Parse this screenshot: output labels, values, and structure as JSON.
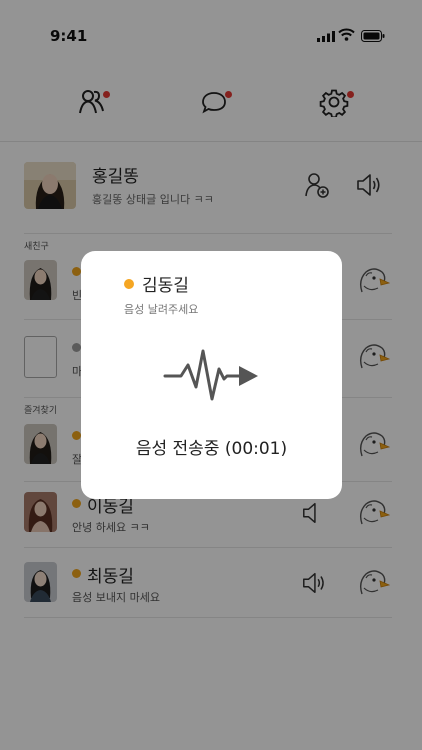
{
  "status_bar": {
    "time": "9:41"
  },
  "tabs": [
    {
      "name": "friends",
      "icon": "people-icon",
      "has_badge": true
    },
    {
      "name": "chats",
      "icon": "chat-bubble-icon",
      "has_badge": true
    },
    {
      "name": "settings",
      "icon": "gear-icon",
      "has_badge": true
    }
  ],
  "profile": {
    "name": "홍길똥",
    "status": "홍길똥 상태글 입니다 ㅋㅋ"
  },
  "sections": {
    "new_friends": "새친구",
    "favorites": "즐겨찾기"
  },
  "friends": [
    {
      "name": "",
      "message": "빈",
      "online": true
    },
    {
      "name": "",
      "message": "마",
      "online": false
    },
    {
      "name": "",
      "message": "잘",
      "online": true
    },
    {
      "name": "이동길",
      "message": "안녕 하세요 ㅋㅋ",
      "online": true
    },
    {
      "name": "최동길",
      "message": "음성 보내지 마세요",
      "online": true
    }
  ],
  "modal": {
    "recipient": "김동길",
    "subtitle": "음성 날려주세요",
    "status": "음성 전송중 (00:01)"
  },
  "colors": {
    "online": "#f5a623",
    "badge": "#e53935",
    "dim_overlay": "rgba(0,0,0,0.42)"
  }
}
